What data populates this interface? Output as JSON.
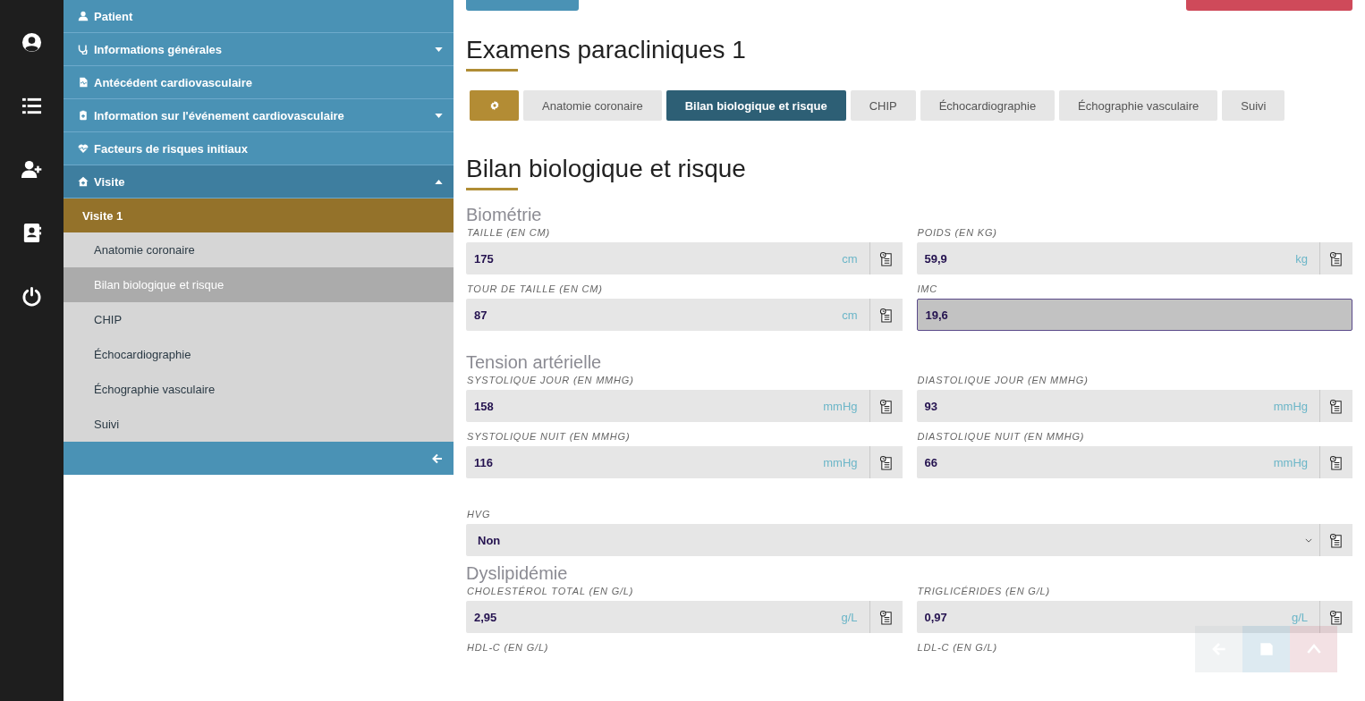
{
  "sidebar": {
    "items": [
      {
        "label": "Patient"
      },
      {
        "label": "Informations générales",
        "expanded": false
      },
      {
        "label": "Antécédent cardiovasculaire"
      },
      {
        "label": "Information sur l'événement cardiovasculaire",
        "expanded": false
      },
      {
        "label": "Facteurs de risques initiaux"
      },
      {
        "label": "Visite",
        "expanded": true,
        "selected": true,
        "children": [
          {
            "label": "Visite 1",
            "selected": true,
            "children": [
              {
                "label": "Anatomie coronaire",
                "selected": false
              },
              {
                "label": "Bilan biologique et risque",
                "selected": true
              },
              {
                "label": "CHIP",
                "selected": false
              },
              {
                "label": "Échocardiographie",
                "selected": false
              },
              {
                "label": "Échographie vasculaire",
                "selected": false
              },
              {
                "label": "Suivi",
                "selected": false
              }
            ]
          }
        ]
      }
    ]
  },
  "page_title": "Examens paracliniques 1",
  "tabs": [
    {
      "label": "Anatomie coronaire",
      "selected": false
    },
    {
      "label": "Bilan biologique et risque",
      "selected": true
    },
    {
      "label": "CHIP",
      "selected": false
    },
    {
      "label": "Échocardiographie",
      "selected": false
    },
    {
      "label": "Échographie vasculaire",
      "selected": false
    },
    {
      "label": "Suivi",
      "selected": false
    }
  ],
  "section_title": "Bilan biologique et risque",
  "groups": [
    {
      "title": "Biométrie",
      "fields": [
        {
          "kind": "input",
          "label": "TAILLE (EN CM)",
          "value": "175",
          "unit": "cm"
        },
        {
          "kind": "input",
          "label": "POIDS (EN KG)",
          "value": "59,9",
          "unit": "kg"
        },
        {
          "kind": "input",
          "label": "TOUR DE TAILLE (EN CM)",
          "value": "87",
          "unit": "cm"
        },
        {
          "kind": "computed",
          "label": "IMC",
          "value": "19,6"
        }
      ]
    },
    {
      "title": "Tension artérielle",
      "fields": [
        {
          "kind": "input",
          "label": "SYSTOLIQUE JOUR (EN MMHG)",
          "value": "158",
          "unit": "mmHg"
        },
        {
          "kind": "input",
          "label": "DIASTOLIQUE JOUR (EN MMHG)",
          "value": "93",
          "unit": "mmHg"
        },
        {
          "kind": "input",
          "label": "SYSTOLIQUE NUIT (EN MMHG)",
          "value": "116",
          "unit": "mmHg"
        },
        {
          "kind": "input",
          "label": "DIASTOLIQUE NUIT (EN MMHG)",
          "value": "66",
          "unit": "mmHg"
        },
        {
          "kind": "select",
          "label": "HVG",
          "value": "Non"
        }
      ]
    },
    {
      "title": "Dyslipidémie",
      "fields": [
        {
          "kind": "input",
          "label": "CHOLESTÉROL TOTAL (EN G/L)",
          "value": "2,95",
          "unit": "g/L"
        },
        {
          "kind": "input",
          "label": "TRIGLICÉRIDES (EN G/L)",
          "value": "0,97",
          "unit": "g/L"
        },
        {
          "kind": "label_only",
          "label": "HDL-C (EN G/L)"
        },
        {
          "kind": "label_only",
          "label": "LDL-C (EN G/L)"
        }
      ]
    }
  ]
}
